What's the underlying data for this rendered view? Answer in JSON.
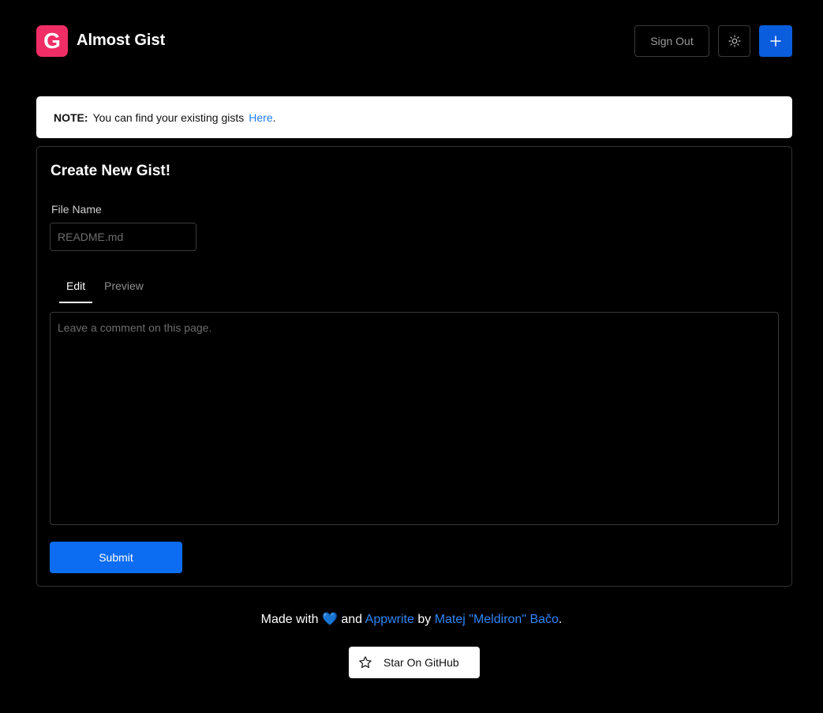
{
  "header": {
    "logo_letter": "G",
    "app_title": "Almost Gist",
    "sign_out_label": "Sign Out",
    "theme_icon": "sun-icon",
    "new_icon": "plus-icon"
  },
  "note": {
    "label": "NOTE:",
    "text": "You can find your existing gists",
    "link_text": "Here",
    "suffix": "."
  },
  "form": {
    "title": "Create New Gist!",
    "file_name_label": "File Name",
    "file_name_value": "",
    "file_name_placeholder": "README.md",
    "tabs": [
      {
        "label": "Edit",
        "active": true
      },
      {
        "label": "Preview",
        "active": false
      }
    ],
    "editor_value": "",
    "editor_placeholder": "Leave a comment on this page.",
    "submit_label": "Submit"
  },
  "footer": {
    "made_with": "Made with",
    "heart": "💙",
    "and": "and",
    "appwrite_link": "Appwrite",
    "by": "by",
    "author_link": "Matej \"Meldiron\" Bačo",
    "period": ".",
    "star_label": "Star On GitHub",
    "star_icon": "star-icon"
  },
  "colors": {
    "background": "#000000",
    "brand": "#f02e65",
    "primary": "#0c6cf2",
    "link": "#2f86f6"
  }
}
